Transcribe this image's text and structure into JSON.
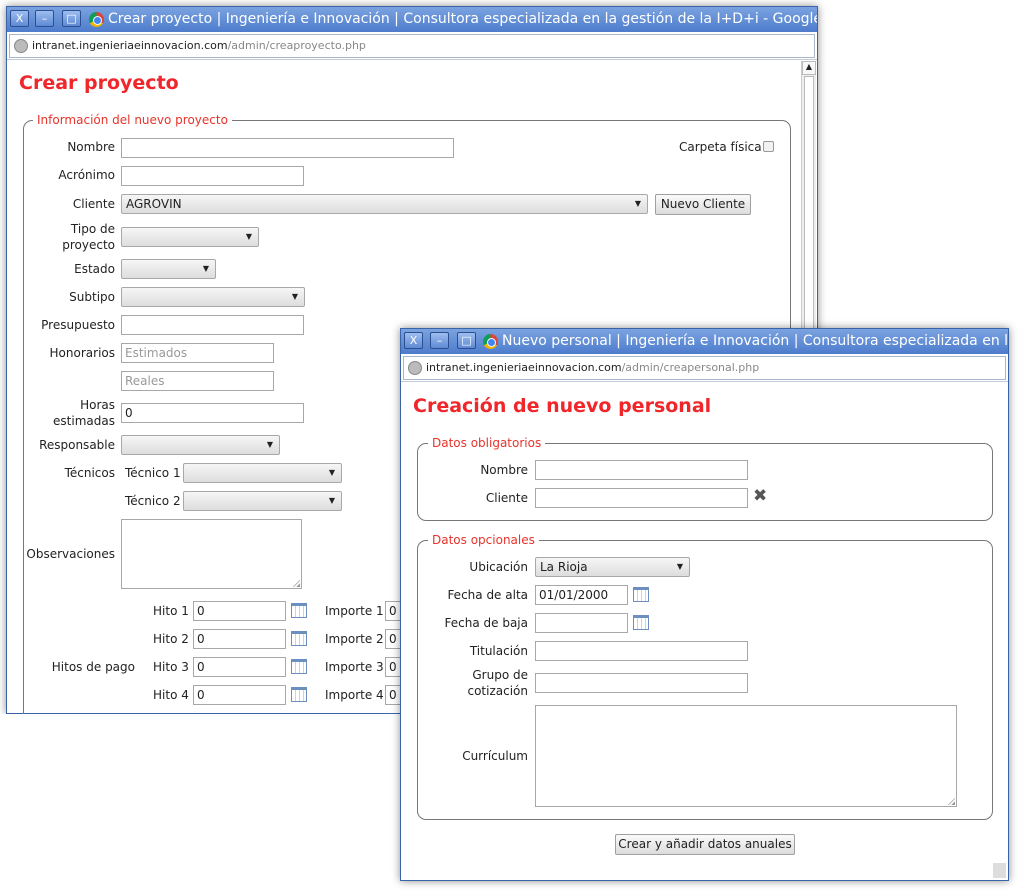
{
  "window1": {
    "title": "Crear proyecto | Ingeniería e Innovación | Consultora especializada en la gestión de la I+D+i - Google Chr...",
    "url_domain": "intranet.ingenieriaeinnovacion.com",
    "url_path": "/admin/creaproyecto.php",
    "heading": "Crear proyecto",
    "legend": "Información del nuevo proyecto",
    "labels": {
      "nombre": "Nombre",
      "acronimo": "Acrónimo",
      "cliente": "Cliente",
      "tipo1": "Tipo de",
      "tipo2": "proyecto",
      "estado": "Estado",
      "subtipo": "Subtipo",
      "presupuesto": "Presupuesto",
      "honorarios": "Honorarios",
      "horas1": "Horas",
      "horas2": "estimadas",
      "responsable": "Responsable",
      "tecnicos": "Técnicos",
      "tecnico1": "Técnico 1",
      "tecnico2": "Técnico 2",
      "observaciones": "Observaciones",
      "hitos_pago": "Hitos de pago",
      "carpeta": "Carpeta física"
    },
    "cliente_value": "AGROVIN",
    "nuevo_cliente": "Nuevo Cliente",
    "honorarios_estimados_placeholder": "Estimados",
    "honorarios_reales_placeholder": "Reales",
    "horas_value": "0",
    "hitos": [
      {
        "label": "Hito 1",
        "value": "0",
        "importe_label": "Importe 1",
        "importe": "0"
      },
      {
        "label": "Hito 2",
        "value": "0",
        "importe_label": "Importe 2",
        "importe": "0"
      },
      {
        "label": "Hito 3",
        "value": "0",
        "importe_label": "Importe 3",
        "importe": "0"
      },
      {
        "label": "Hito 4",
        "value": "0",
        "importe_label": "Importe 4",
        "importe": "0"
      }
    ]
  },
  "window2": {
    "title": "Nuevo personal | Ingeniería e Innovación | Consultora especializada en la ...",
    "url_domain": "intranet.ingenieriaeinnovacion.com",
    "url_path": "/admin/creapersonal.php",
    "heading": "Creación de nuevo personal",
    "legend_obligatorios": "Datos obligatorios",
    "legend_opcionales": "Datos opcionales",
    "labels": {
      "nombre": "Nombre",
      "cliente": "Cliente",
      "ubicacion": "Ubicación",
      "fecha_alta": "Fecha de alta",
      "fecha_baja": "Fecha de baja",
      "titulacion": "Titulación",
      "grupo1": "Grupo de",
      "grupo2": "cotización",
      "curriculum": "Currículum"
    },
    "ubicacion_value": "La Rioja",
    "fecha_alta_value": "01/01/2000",
    "submit": "Crear y añadir datos anuales"
  },
  "window_buttons": {
    "close": "X",
    "minimize": "–",
    "maximize": "□"
  }
}
